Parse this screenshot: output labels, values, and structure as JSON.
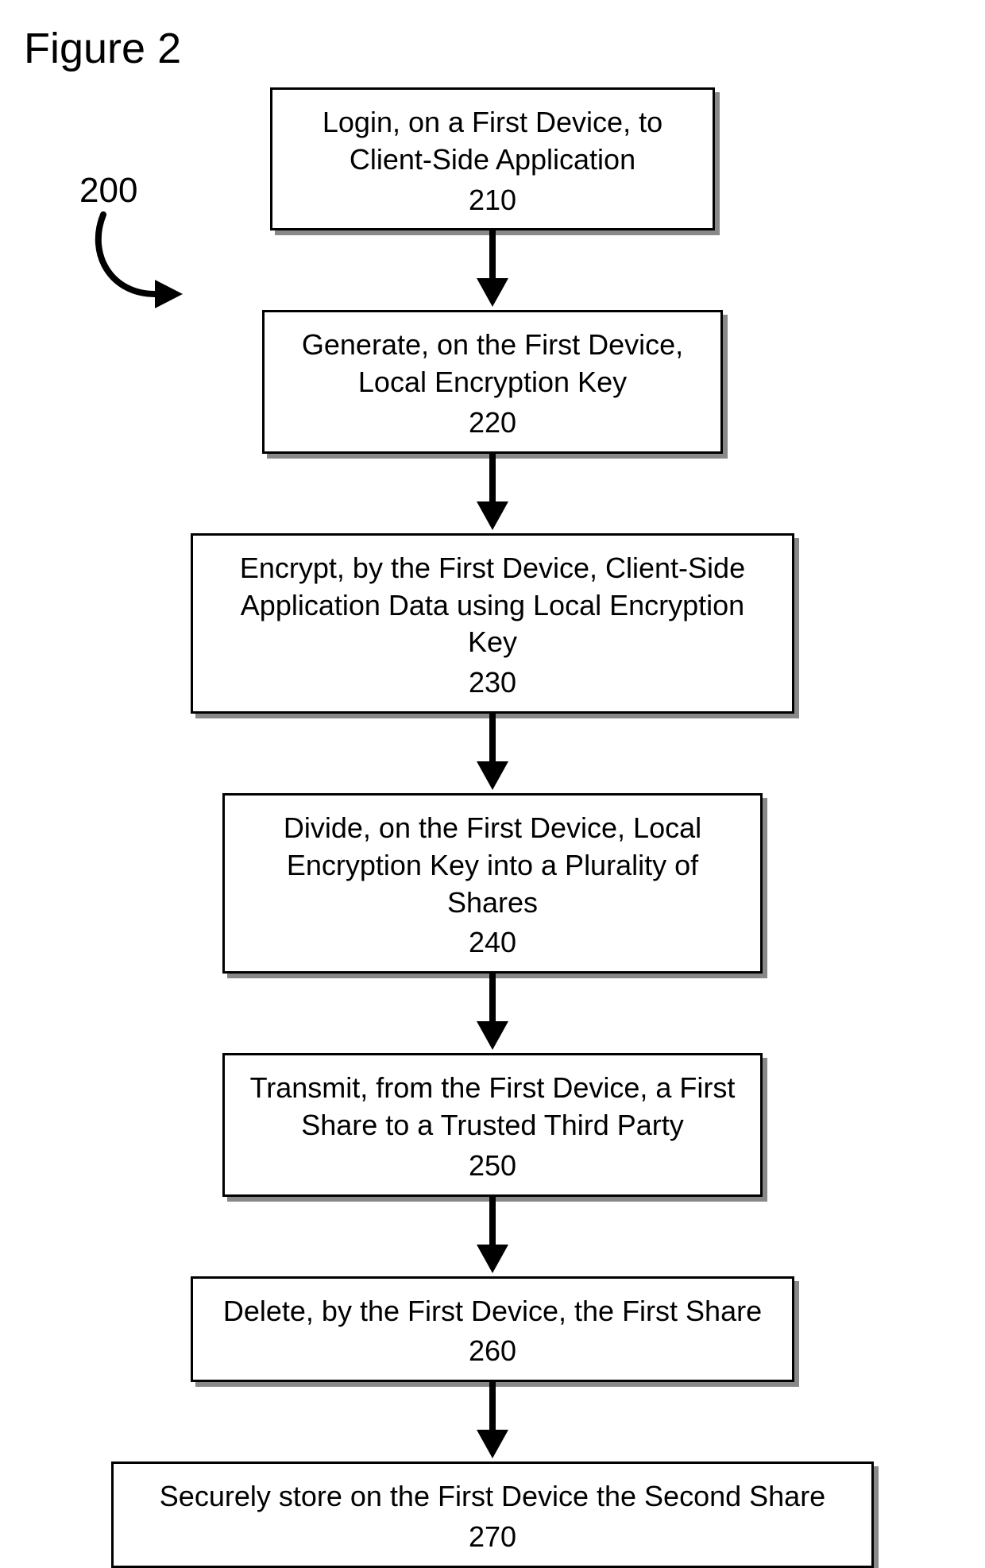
{
  "title": "Figure 2",
  "reference_number": "200",
  "steps": [
    {
      "text": "Login, on a First Device, to Client-Side Application",
      "number": "210"
    },
    {
      "text": "Generate, on the First Device, Local Encryption Key",
      "number": "220"
    },
    {
      "text": "Encrypt, by the First Device, Client-Side Application Data using Local Encryption Key",
      "number": "230"
    },
    {
      "text": "Divide, on the First Device, Local Encryption Key into a Plurality of Shares",
      "number": "240"
    },
    {
      "text": "Transmit, from the First Device, a First Share to a Trusted Third Party",
      "number": "250"
    },
    {
      "text": "Delete, by the First Device, the First Share",
      "number": "260"
    },
    {
      "text": "Securely store on the First Device the Second Share",
      "number": "270"
    }
  ]
}
